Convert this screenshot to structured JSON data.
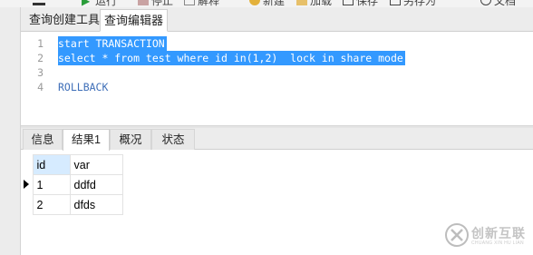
{
  "toolbar": {
    "items": [
      {
        "label": "运行",
        "icon": "play-icon"
      },
      {
        "label": "停止",
        "icon": "stop-icon"
      },
      {
        "label": "解释",
        "icon": "explain-icon"
      },
      {
        "label": "新建",
        "icon": "new-icon"
      },
      {
        "label": "加载",
        "icon": "load-icon"
      },
      {
        "label": "保存",
        "icon": "save-icon"
      },
      {
        "label": "另存为",
        "icon": "save-as-icon"
      },
      {
        "label": "文档",
        "icon": "document-icon"
      }
    ]
  },
  "query_tabs": [
    {
      "label": "查询创建工具",
      "active": false
    },
    {
      "label": "查询编辑器",
      "active": true
    }
  ],
  "editor": {
    "lines": [
      {
        "num": "1",
        "text": "start TRANSACTION",
        "selected": true
      },
      {
        "num": "2",
        "text": "select * from test where id in(1,2)  lock in share mode",
        "selected": true
      },
      {
        "num": "3",
        "text": "",
        "selected": false
      },
      {
        "num": "4",
        "text": "ROLLBACK",
        "selected": false
      }
    ]
  },
  "result_tabs": [
    {
      "label": "信息",
      "active": false
    },
    {
      "label": "结果1",
      "active": true
    },
    {
      "label": "概况",
      "active": false
    },
    {
      "label": "状态",
      "active": false
    }
  ],
  "grid": {
    "columns": [
      "id",
      "var"
    ],
    "rows": [
      {
        "id": "1",
        "var": "ddfd",
        "current": true
      },
      {
        "id": "2",
        "var": "dfds",
        "current": false
      }
    ]
  },
  "watermark": {
    "name": "创新互联",
    "sub": "CHUANG XIN HU LIAN"
  },
  "colors": {
    "selection": "#3399ff",
    "keyword": "#3f6fb8",
    "header_highlight": "#d6ebff"
  }
}
